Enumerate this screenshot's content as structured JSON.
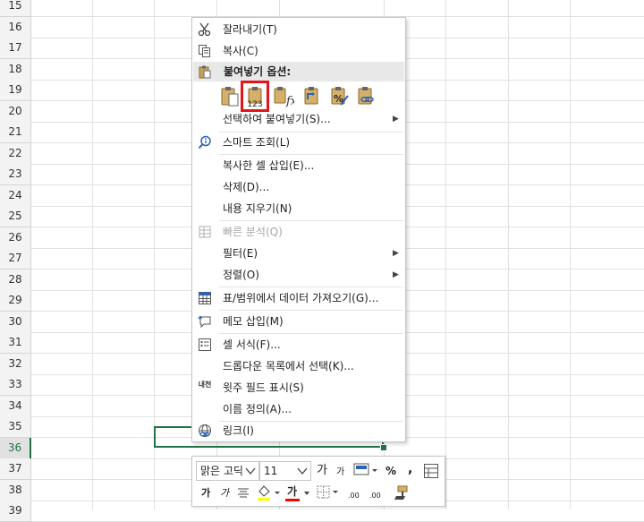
{
  "rows": [
    "15",
    "16",
    "17",
    "18",
    "19",
    "20",
    "21",
    "22",
    "23",
    "24",
    "25",
    "26",
    "27",
    "28",
    "29",
    "30",
    "31",
    "32",
    "33",
    "34",
    "35",
    "36",
    "37",
    "38",
    "39"
  ],
  "active_row": "36",
  "context_menu": {
    "cut": "잘라내기(T)",
    "copy": "복사(C)",
    "paste_options": "붙여넣기 옵션:",
    "paste_special": "선택하여 붙여넣기(S)...",
    "smart_lookup": "스마트 조회(L)",
    "insert_copied": "복사한 셀 삽입(E)...",
    "delete": "삭제(D)...",
    "clear_contents": "내용 지우기(N)",
    "quick_analysis": "빠른 분석(Q)",
    "filter": "필터(E)",
    "sort": "정렬(O)",
    "get_data": "표/범위에서 데이터 가져오기(G)...",
    "insert_comment": "메모 삽입(M)",
    "format_cells": "셀 서식(F)...",
    "pick_dropdown": "드롭다운 목록에서 선택(K)...",
    "phonetic": "윗주 필드 표시(S)",
    "define_name": "이름 정의(A)...",
    "link": "링크(I)",
    "phonetic_icon_text": "내천",
    "paste_values_badge": "123",
    "formula_glyph": "fx"
  },
  "mini_toolbar": {
    "font_name": "맑은 고딕",
    "font_size": "11",
    "grow_font": "가",
    "shrink_font": "가",
    "percent": "%",
    "comma": ",",
    "bold": "가",
    "italic": "가",
    "font_color_glyph": "가",
    "dec_inc": ".00",
    "dec_dec": ".00",
    "fill_color": "#ffff00",
    "font_color": "#ff0000"
  },
  "colors": {
    "accent": "#217346",
    "highlight": "#e4141b"
  }
}
